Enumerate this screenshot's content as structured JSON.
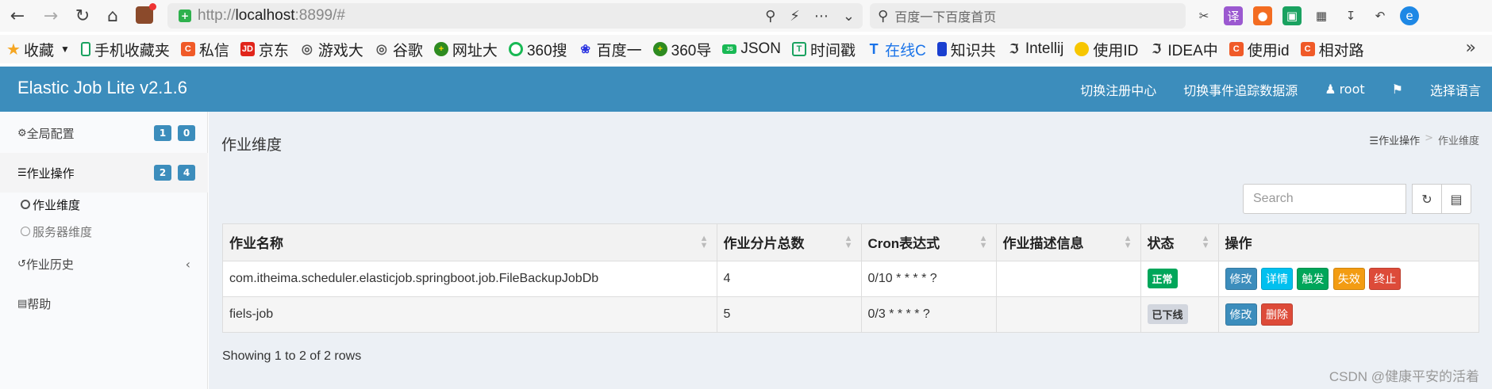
{
  "browser": {
    "url_prefix": "http://",
    "url_host": "localhost",
    "url_rest": ":8899/#",
    "search_placeholder": "百度一下百度首页",
    "bookmarks": [
      "收藏",
      "手机收藏夹",
      "私信",
      "京东",
      "游戏大",
      "谷歌",
      "网址大",
      "360搜",
      "百度一",
      "360导",
      "JSON",
      "时间戳",
      "在线C",
      "知识共",
      "Intellij",
      "使用ID",
      "IDEA中",
      "使用id",
      "相对路"
    ]
  },
  "header": {
    "title": "Elastic Job Lite v2.1.6",
    "nav": {
      "switch_registry": "切换注册中心",
      "switch_datasource": "切换事件追踪数据源",
      "user": "root",
      "language": "选择语言"
    }
  },
  "sidebar": {
    "global_config": {
      "label": "全局配置",
      "badge1": "1",
      "badge2": "0"
    },
    "job_ops": {
      "label": "作业操作",
      "badge1": "2",
      "badge2": "4"
    },
    "job_dimension": "作业维度",
    "server_dimension": "服务器维度",
    "job_history": "作业历史",
    "help": "帮助"
  },
  "main": {
    "page_title": "作业维度",
    "breadcrumb": {
      "parent": "作业操作",
      "current": "作业维度"
    },
    "search_placeholder": "Search",
    "table": {
      "headers": [
        "作业名称",
        "作业分片总数",
        "Cron表达式",
        "作业描述信息",
        "状态",
        "操作"
      ],
      "rows": [
        {
          "name": "com.itheima.scheduler.elasticjob.springboot.job.FileBackupJobDb",
          "shards": "4",
          "cron": "0/10 * * * * ?",
          "desc": "",
          "status": "正常",
          "ops": [
            "修改",
            "详情",
            "触发",
            "失效",
            "终止"
          ]
        },
        {
          "name": "fiels-job",
          "shards": "5",
          "cron": "0/3 * * * * ?",
          "desc": "",
          "status": "已下线",
          "ops": [
            "修改",
            "删除"
          ]
        }
      ]
    },
    "pagination_info": "Showing 1 to 2 of 2 rows",
    "watermark": "CSDN @健康平安的活着"
  },
  "colors": {
    "header_bg": "#3c8dbc",
    "content_bg": "#ecf0f5",
    "ok_green": "#00a65a",
    "danger_red": "#dd4b39"
  }
}
